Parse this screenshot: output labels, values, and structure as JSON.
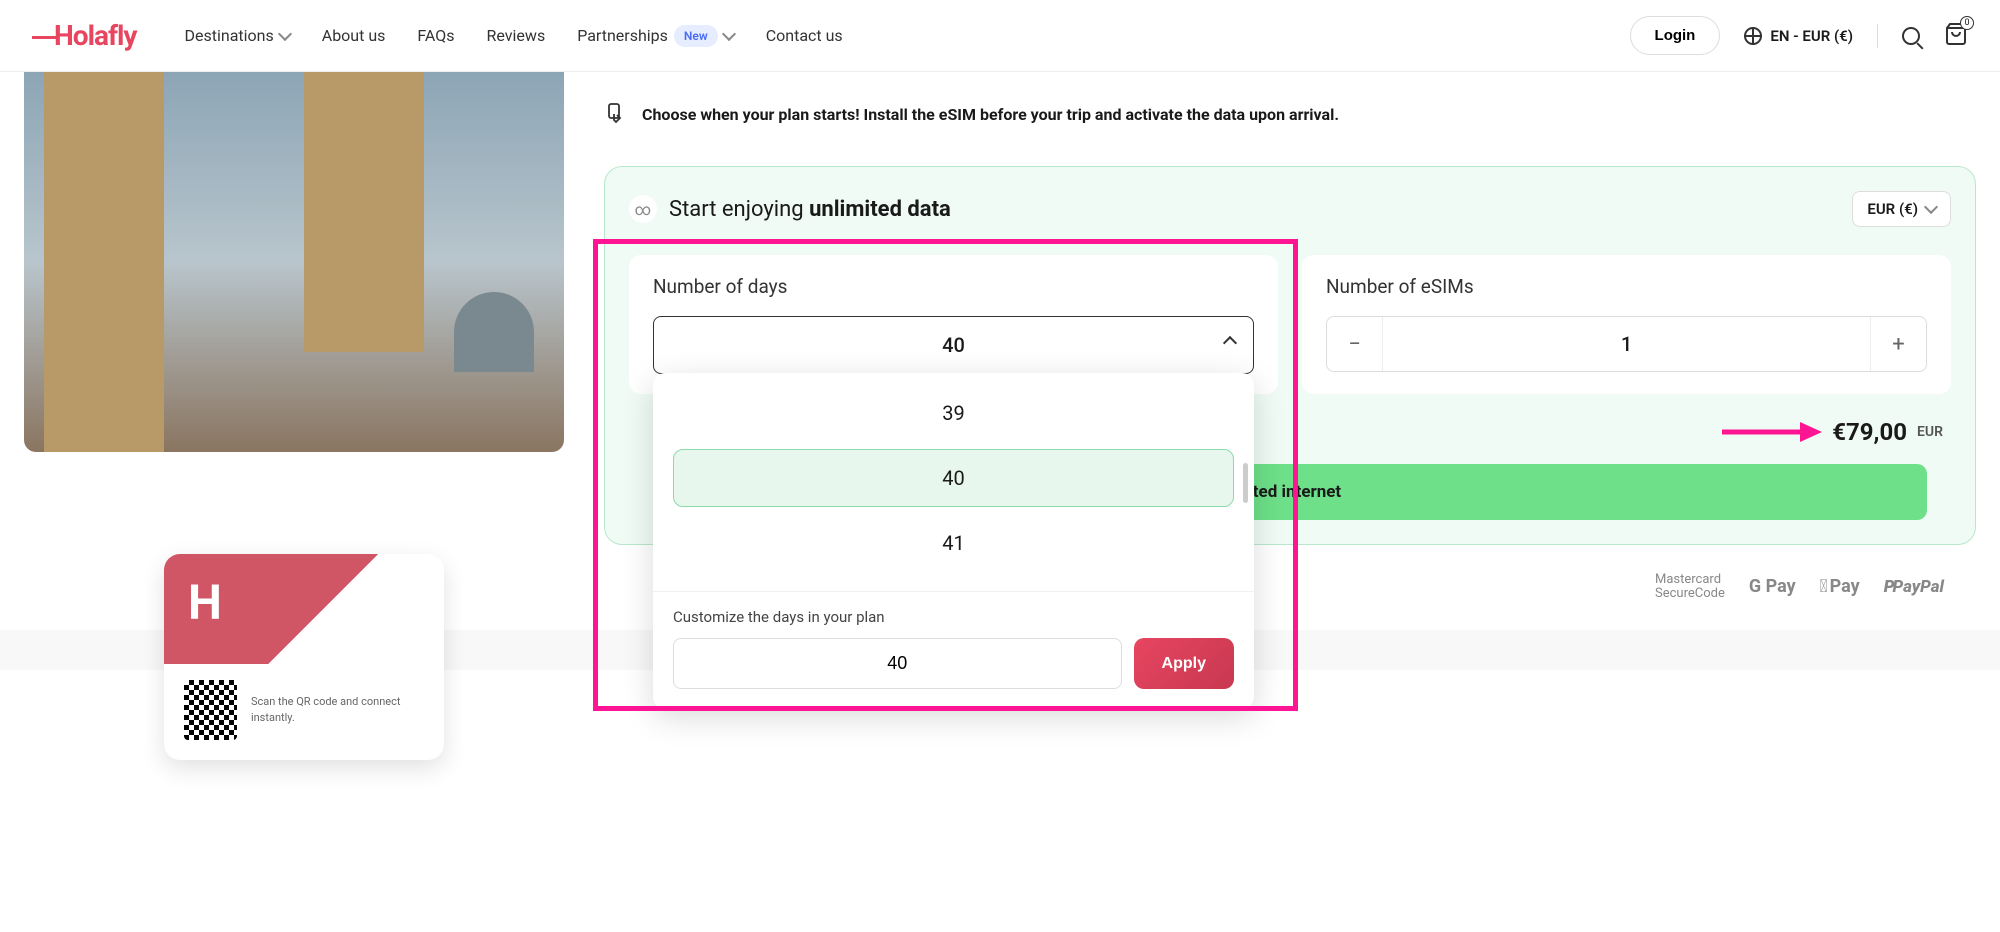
{
  "header": {
    "logo": "Holafly",
    "nav": {
      "destinations": "Destinations",
      "about": "About us",
      "faqs": "FAQs",
      "reviews": "Reviews",
      "partnerships": "Partnerships",
      "partnerships_badge": "New",
      "contact": "Contact us"
    },
    "login": "Login",
    "lang": "EN - EUR (€)",
    "cart_count": "0"
  },
  "card": {
    "qr_text": "Scan the QR code and connect instantly."
  },
  "choose_text": "Choose when your plan starts! Install the eSIM before your trip and activate the data upon arrival.",
  "config": {
    "start_text": "Start enjoying ",
    "unlimited": "unlimited data",
    "currency": "EUR (€)",
    "days_label": "Number of days",
    "days_value": "40",
    "esims_label": "Number of eSIMs",
    "esims_value": "1",
    "price": "€79,00",
    "price_currency": "EUR",
    "cta": "nited internet"
  },
  "dropdown": {
    "options": [
      "39",
      "40",
      "41"
    ],
    "selected": "40",
    "custom_label": "Customize the days in your plan",
    "custom_value": "40",
    "apply": "Apply"
  },
  "payments": {
    "mc1": "Mastercard",
    "mc2": "SecureCode",
    "gpay": "G Pay",
    "apay": "Pay",
    "paypal": "PayPal"
  }
}
